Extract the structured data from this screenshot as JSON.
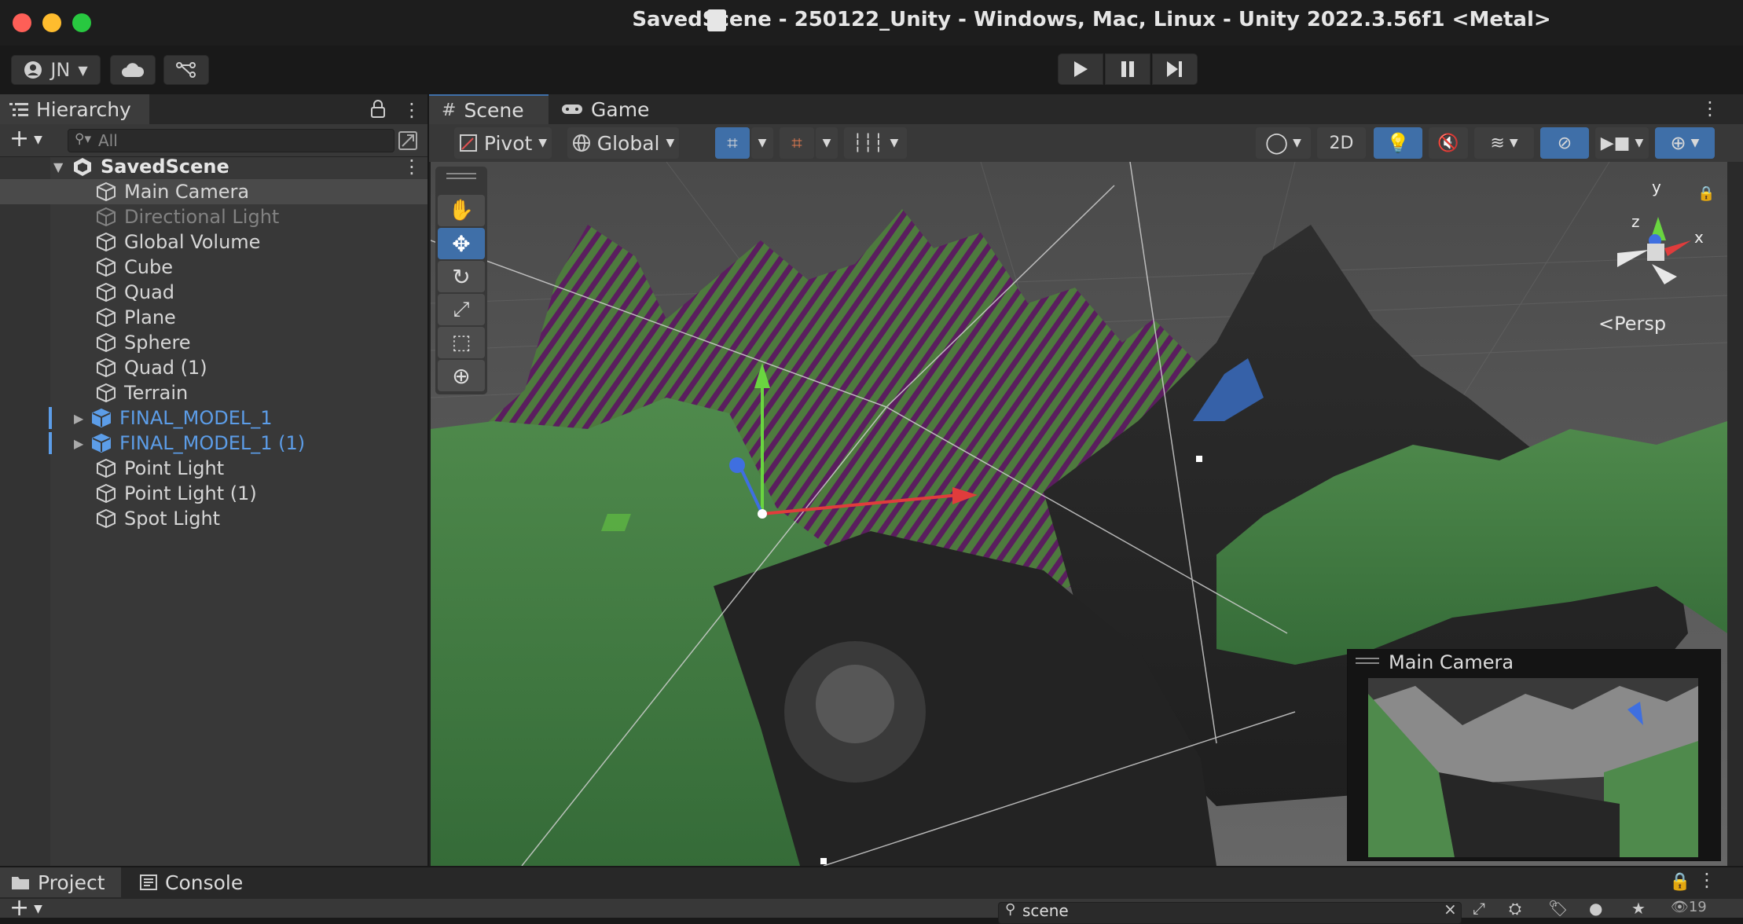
{
  "window": {
    "title": "SavedScene - 250122_Unity - Windows, Mac, Linux - Unity 2022.3.56f1 <Metal>",
    "traffic_lights": {
      "close": "#fe5f57",
      "minimize": "#febc2e",
      "zoom": "#28c840"
    }
  },
  "toolbar": {
    "account_label": "JN",
    "account_icon": "user-icon",
    "cloud_icon": "cloud-icon",
    "collab_icon": "version-control-icon",
    "play_icon": "play-icon",
    "pause_icon": "pause-icon",
    "step_icon": "step-icon"
  },
  "hierarchy": {
    "tab_label": "Hierarchy",
    "search_placeholder": "All",
    "scene_name": "SavedScene",
    "items": [
      {
        "label": "Main Camera",
        "state": "selected"
      },
      {
        "label": "Directional Light",
        "state": "disabled"
      },
      {
        "label": "Global Volume",
        "state": "normal"
      },
      {
        "label": "Cube",
        "state": "normal"
      },
      {
        "label": "Quad",
        "state": "normal"
      },
      {
        "label": "Plane",
        "state": "normal"
      },
      {
        "label": "Sphere",
        "state": "normal"
      },
      {
        "label": "Quad (1)",
        "state": "normal"
      },
      {
        "label": "Terrain",
        "state": "normal"
      },
      {
        "label": "FINAL_MODEL_1",
        "state": "prefab"
      },
      {
        "label": "FINAL_MODEL_1 (1)",
        "state": "prefab"
      },
      {
        "label": "Point Light",
        "state": "normal"
      },
      {
        "label": "Point Light (1)",
        "state": "normal"
      },
      {
        "label": "Spot Light",
        "state": "normal"
      }
    ],
    "colors": {
      "prefab": "#5c9de8",
      "disabled": "#828282",
      "normal": "#d6d6d6",
      "selected_bg": "#4a4a4a"
    }
  },
  "scene": {
    "tabs": [
      {
        "label": "Scene",
        "icon": "grid-icon"
      },
      {
        "label": "Game",
        "icon": "gamepad-icon"
      }
    ],
    "pivot_label": "Pivot",
    "global_label": "Global",
    "mode_2d_label": "2D",
    "gizmo_axes": {
      "y": "y",
      "x": "x",
      "z": "z"
    },
    "projection_label": "Persp",
    "camera_preview_title": "Main Camera",
    "active_accent": "#3f6fa8"
  },
  "bottom": {
    "tabs": [
      {
        "label": "Project",
        "icon": "folder-icon"
      },
      {
        "label": "Console",
        "icon": "console-icon"
      }
    ],
    "search_value": "scene",
    "hidden_count": "19"
  }
}
